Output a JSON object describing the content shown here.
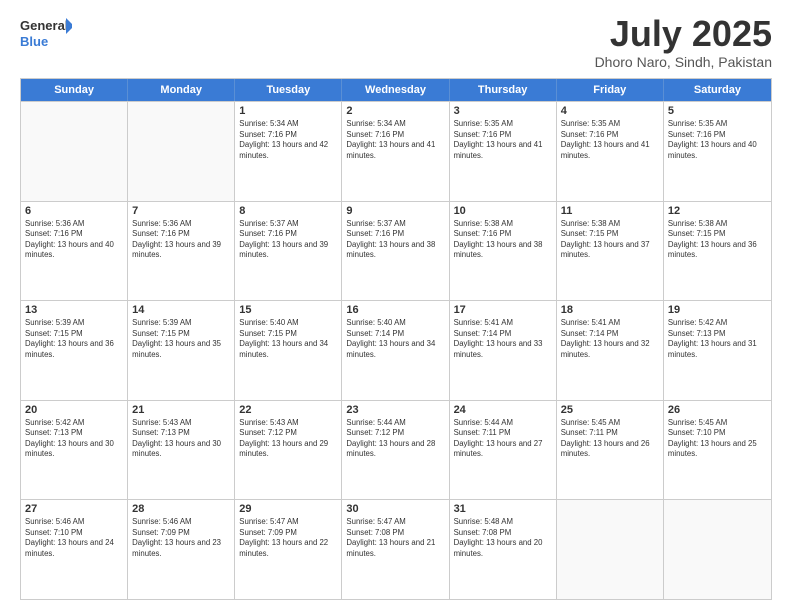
{
  "logo": {
    "line1": "General",
    "line2": "Blue"
  },
  "title": "July 2025",
  "subtitle": "Dhoro Naro, Sindh, Pakistan",
  "days_header": [
    "Sunday",
    "Monday",
    "Tuesday",
    "Wednesday",
    "Thursday",
    "Friday",
    "Saturday"
  ],
  "weeks": [
    [
      {
        "day": "",
        "empty": true
      },
      {
        "day": "",
        "empty": true
      },
      {
        "day": "1",
        "sunrise": "5:34 AM",
        "sunset": "7:16 PM",
        "daylight": "13 hours and 42 minutes."
      },
      {
        "day": "2",
        "sunrise": "5:34 AM",
        "sunset": "7:16 PM",
        "daylight": "13 hours and 41 minutes."
      },
      {
        "day": "3",
        "sunrise": "5:35 AM",
        "sunset": "7:16 PM",
        "daylight": "13 hours and 41 minutes."
      },
      {
        "day": "4",
        "sunrise": "5:35 AM",
        "sunset": "7:16 PM",
        "daylight": "13 hours and 41 minutes."
      },
      {
        "day": "5",
        "sunrise": "5:35 AM",
        "sunset": "7:16 PM",
        "daylight": "13 hours and 40 minutes."
      }
    ],
    [
      {
        "day": "6",
        "sunrise": "5:36 AM",
        "sunset": "7:16 PM",
        "daylight": "13 hours and 40 minutes."
      },
      {
        "day": "7",
        "sunrise": "5:36 AM",
        "sunset": "7:16 PM",
        "daylight": "13 hours and 39 minutes."
      },
      {
        "day": "8",
        "sunrise": "5:37 AM",
        "sunset": "7:16 PM",
        "daylight": "13 hours and 39 minutes."
      },
      {
        "day": "9",
        "sunrise": "5:37 AM",
        "sunset": "7:16 PM",
        "daylight": "13 hours and 38 minutes."
      },
      {
        "day": "10",
        "sunrise": "5:38 AM",
        "sunset": "7:16 PM",
        "daylight": "13 hours and 38 minutes."
      },
      {
        "day": "11",
        "sunrise": "5:38 AM",
        "sunset": "7:15 PM",
        "daylight": "13 hours and 37 minutes."
      },
      {
        "day": "12",
        "sunrise": "5:38 AM",
        "sunset": "7:15 PM",
        "daylight": "13 hours and 36 minutes."
      }
    ],
    [
      {
        "day": "13",
        "sunrise": "5:39 AM",
        "sunset": "7:15 PM",
        "daylight": "13 hours and 36 minutes."
      },
      {
        "day": "14",
        "sunrise": "5:39 AM",
        "sunset": "7:15 PM",
        "daylight": "13 hours and 35 minutes."
      },
      {
        "day": "15",
        "sunrise": "5:40 AM",
        "sunset": "7:15 PM",
        "daylight": "13 hours and 34 minutes."
      },
      {
        "day": "16",
        "sunrise": "5:40 AM",
        "sunset": "7:14 PM",
        "daylight": "13 hours and 34 minutes."
      },
      {
        "day": "17",
        "sunrise": "5:41 AM",
        "sunset": "7:14 PM",
        "daylight": "13 hours and 33 minutes."
      },
      {
        "day": "18",
        "sunrise": "5:41 AM",
        "sunset": "7:14 PM",
        "daylight": "13 hours and 32 minutes."
      },
      {
        "day": "19",
        "sunrise": "5:42 AM",
        "sunset": "7:13 PM",
        "daylight": "13 hours and 31 minutes."
      }
    ],
    [
      {
        "day": "20",
        "sunrise": "5:42 AM",
        "sunset": "7:13 PM",
        "daylight": "13 hours and 30 minutes."
      },
      {
        "day": "21",
        "sunrise": "5:43 AM",
        "sunset": "7:13 PM",
        "daylight": "13 hours and 30 minutes."
      },
      {
        "day": "22",
        "sunrise": "5:43 AM",
        "sunset": "7:12 PM",
        "daylight": "13 hours and 29 minutes."
      },
      {
        "day": "23",
        "sunrise": "5:44 AM",
        "sunset": "7:12 PM",
        "daylight": "13 hours and 28 minutes."
      },
      {
        "day": "24",
        "sunrise": "5:44 AM",
        "sunset": "7:11 PM",
        "daylight": "13 hours and 27 minutes."
      },
      {
        "day": "25",
        "sunrise": "5:45 AM",
        "sunset": "7:11 PM",
        "daylight": "13 hours and 26 minutes."
      },
      {
        "day": "26",
        "sunrise": "5:45 AM",
        "sunset": "7:10 PM",
        "daylight": "13 hours and 25 minutes."
      }
    ],
    [
      {
        "day": "27",
        "sunrise": "5:46 AM",
        "sunset": "7:10 PM",
        "daylight": "13 hours and 24 minutes."
      },
      {
        "day": "28",
        "sunrise": "5:46 AM",
        "sunset": "7:09 PM",
        "daylight": "13 hours and 23 minutes."
      },
      {
        "day": "29",
        "sunrise": "5:47 AM",
        "sunset": "7:09 PM",
        "daylight": "13 hours and 22 minutes."
      },
      {
        "day": "30",
        "sunrise": "5:47 AM",
        "sunset": "7:08 PM",
        "daylight": "13 hours and 21 minutes."
      },
      {
        "day": "31",
        "sunrise": "5:48 AM",
        "sunset": "7:08 PM",
        "daylight": "13 hours and 20 minutes."
      },
      {
        "day": "",
        "empty": true
      },
      {
        "day": "",
        "empty": true
      }
    ]
  ]
}
